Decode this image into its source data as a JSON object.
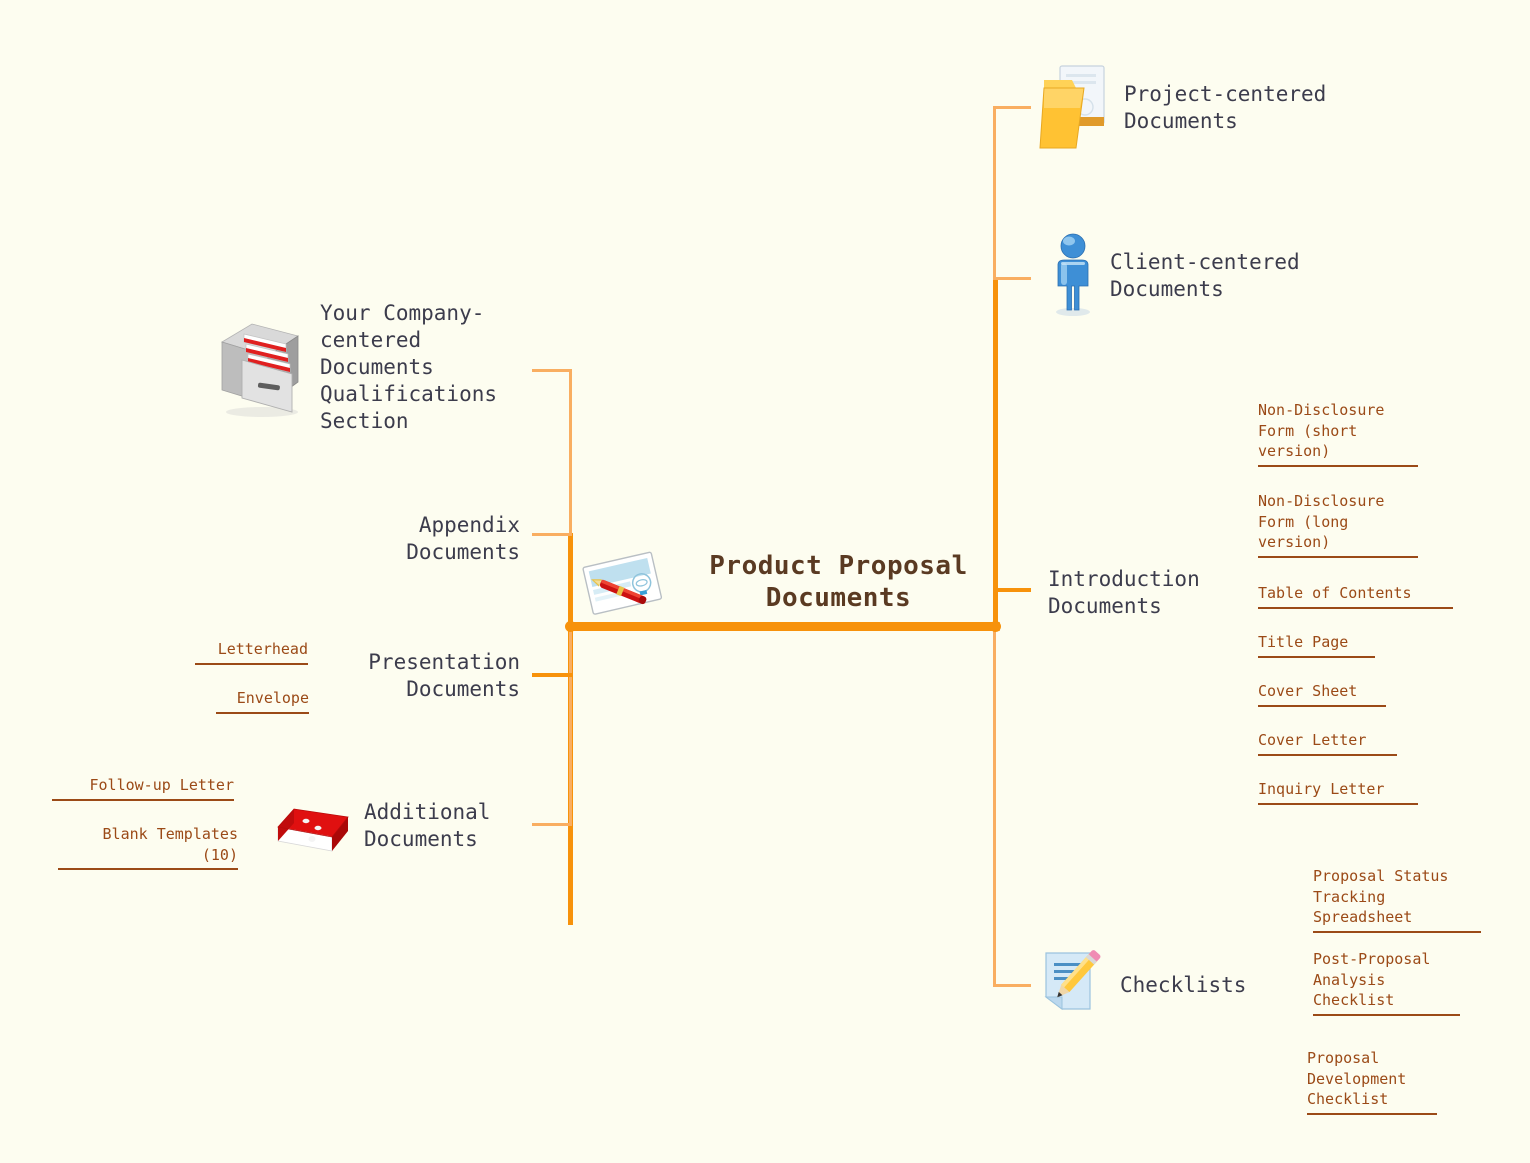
{
  "meta": {
    "kind": "mind-map",
    "background_color": "#FDFDF0",
    "trunk_color": "#F9AE61",
    "trunk_accent_color": "#F7920B",
    "branch_text_color": "#3C3C4C",
    "leaf_text_color": "#9B4A17",
    "center_text_color": "#5A3A22"
  },
  "central": {
    "title": "Product Proposal\nDocuments",
    "icon": "document-pen-icon"
  },
  "branches": {
    "right": [
      {
        "id": "project-centered-documents",
        "label": "Project-centered\nDocuments",
        "icon": "folder-icon",
        "leaves": []
      },
      {
        "id": "client-centered-documents",
        "label": "Client-centered\nDocuments",
        "icon": "person-icon",
        "leaves": []
      },
      {
        "id": "introduction-documents",
        "label": "Introduction\nDocuments",
        "icon": null,
        "leaves": [
          {
            "id": "non-disclosure-form-short",
            "label": "Non-Disclosure\nForm (short\nversion)"
          },
          {
            "id": "non-disclosure-form-long",
            "label": "Non-Disclosure\nForm (long\nversion)"
          },
          {
            "id": "table-of-contents",
            "label": "Table of Contents"
          },
          {
            "id": "title-page",
            "label": "Title Page"
          },
          {
            "id": "cover-sheet",
            "label": "Cover Sheet"
          },
          {
            "id": "cover-letter",
            "label": "Cover Letter"
          },
          {
            "id": "inquiry-letter",
            "label": "Inquiry Letter"
          }
        ]
      },
      {
        "id": "checklists",
        "label": "Checklists",
        "icon": "note-pencil-icon",
        "leaves": [
          {
            "id": "proposal-status-tracking-spreadsheet",
            "label": "Proposal Status\nTracking\nSpreadsheet"
          },
          {
            "id": "post-proposal-analysis-checklist",
            "label": "Post-Proposal\nAnalysis\nChecklist"
          },
          {
            "id": "proposal-development-checklist",
            "label": "Proposal\nDevelopment\nChecklist"
          }
        ]
      }
    ],
    "left": [
      {
        "id": "your-company-centered-documents",
        "label": "Your Company-\ncentered\nDocuments\nQualifications\nSection",
        "icon": "file-cabinet-icon",
        "leaves": []
      },
      {
        "id": "appendix-documents",
        "label": "Appendix\nDocuments",
        "icon": null,
        "leaves": []
      },
      {
        "id": "presentation-documents",
        "label": "Presentation\nDocuments",
        "icon": null,
        "leaves": [
          {
            "id": "letterhead",
            "label": "Letterhead"
          },
          {
            "id": "envelope",
            "label": "Envelope"
          }
        ]
      },
      {
        "id": "additional-documents",
        "label": "Additional\nDocuments",
        "icon": "red-book-icon",
        "leaves": [
          {
            "id": "follow-up-letter",
            "label": "Follow-up Letter"
          },
          {
            "id": "blank-templates",
            "label": "Blank Templates\n(10)"
          }
        ]
      }
    ]
  }
}
